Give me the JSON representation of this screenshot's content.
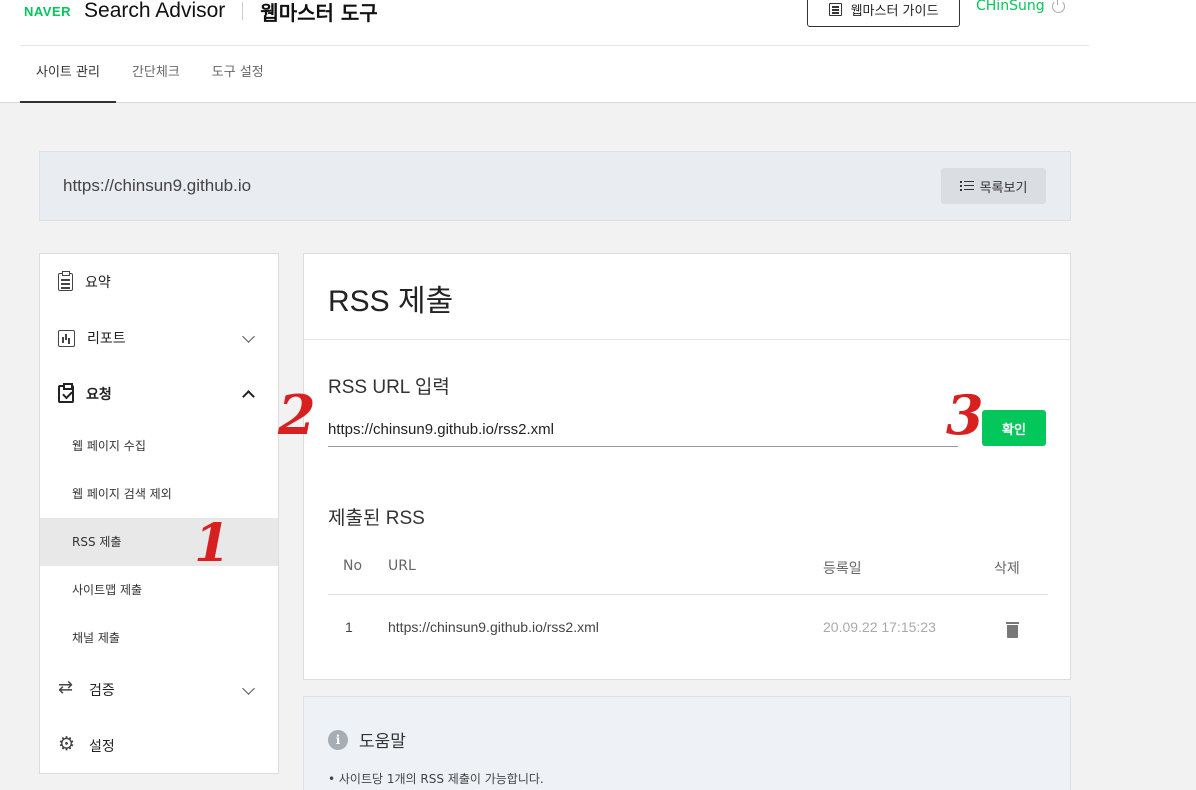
{
  "header": {
    "naver_logo": "NAVER",
    "brand": "Search Advisor",
    "tool_title": "웹마스터 도구",
    "guide_button": "웹마스터 가이드",
    "username": "CHinSung"
  },
  "tabs": [
    {
      "label": "사이트 관리",
      "active": true
    },
    {
      "label": "간단체크",
      "active": false
    },
    {
      "label": "도구 설정",
      "active": false
    }
  ],
  "site": {
    "url": "https://chinsun9.github.io",
    "list_button": "목록보기"
  },
  "sidebar": {
    "summary": "요약",
    "report": "리포트",
    "request": "요청",
    "sub_items": [
      {
        "label": "웹 페이지 수집"
      },
      {
        "label": "웹 페이지 검색 제외"
      },
      {
        "label": "RSS 제출",
        "active": true
      },
      {
        "label": "사이트맵 제출"
      },
      {
        "label": "채널 제출"
      }
    ],
    "verify": "검증",
    "settings": "설정"
  },
  "main": {
    "title": "RSS 제출",
    "input_label": "RSS URL 입력",
    "input_value": "https://chinsun9.github.io/rss2.xml",
    "confirm_button": "확인",
    "submitted_title": "제출된 RSS",
    "columns": {
      "no": "No",
      "url": "URL",
      "date": "등록일",
      "delete": "삭제"
    },
    "rows": [
      {
        "no": "1",
        "url": "https://chinsun9.github.io/rss2.xml",
        "date": "20.09.22 17:15:23"
      }
    ]
  },
  "help": {
    "title": "도움말",
    "items": [
      "• 사이트당 1개의 RSS 제출이 가능합니다."
    ]
  },
  "annotations": {
    "one": "1",
    "two": "2",
    "three": "3"
  },
  "colors": {
    "accent": "#03c75a"
  }
}
